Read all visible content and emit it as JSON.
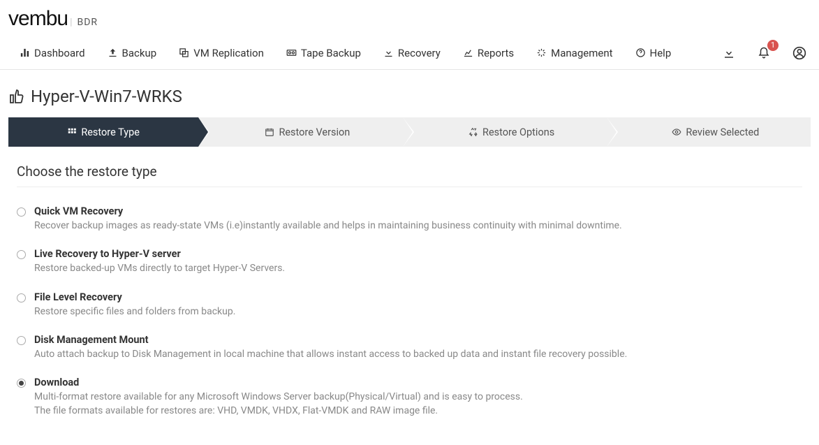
{
  "brand": {
    "name": "vembu",
    "sub": "BDR"
  },
  "nav": {
    "dashboard": "Dashboard",
    "backup": "Backup",
    "vm_replication": "VM Replication",
    "tape_backup": "Tape Backup",
    "recovery": "Recovery",
    "reports": "Reports",
    "management": "Management",
    "help": "Help"
  },
  "notifications": {
    "count": "1"
  },
  "page": {
    "title": "Hyper-V-Win7-WRKS"
  },
  "wizard": {
    "step1": "Restore Type",
    "step2": "Restore Version",
    "step3": "Restore Options",
    "step4": "Review Selected"
  },
  "section": {
    "heading": "Choose the restore type"
  },
  "options": {
    "quick_vm": {
      "title": "Quick VM Recovery",
      "desc": "Recover backup images as ready-state VMs (i.e)instantly available and helps in maintaining business continuity with minimal downtime."
    },
    "live_recovery": {
      "title": "Live Recovery to Hyper-V server",
      "desc": "Restore backed-up VMs directly to target Hyper-V Servers."
    },
    "file_level": {
      "title": "File Level Recovery",
      "desc": "Restore specific files and folders from backup."
    },
    "disk_mgmt": {
      "title": "Disk Management Mount",
      "desc": "Auto attach backup to Disk Management in local machine that allows instant access to backed up data and instant file recovery possible."
    },
    "download": {
      "title": "Download",
      "desc": "Multi-format restore available for any Microsoft Windows Server backup(Physical/Virtual) and is easy to process.\nThe file formats available for restores are: VHD, VMDK, VHDX, Flat-VMDK and RAW image file."
    }
  }
}
